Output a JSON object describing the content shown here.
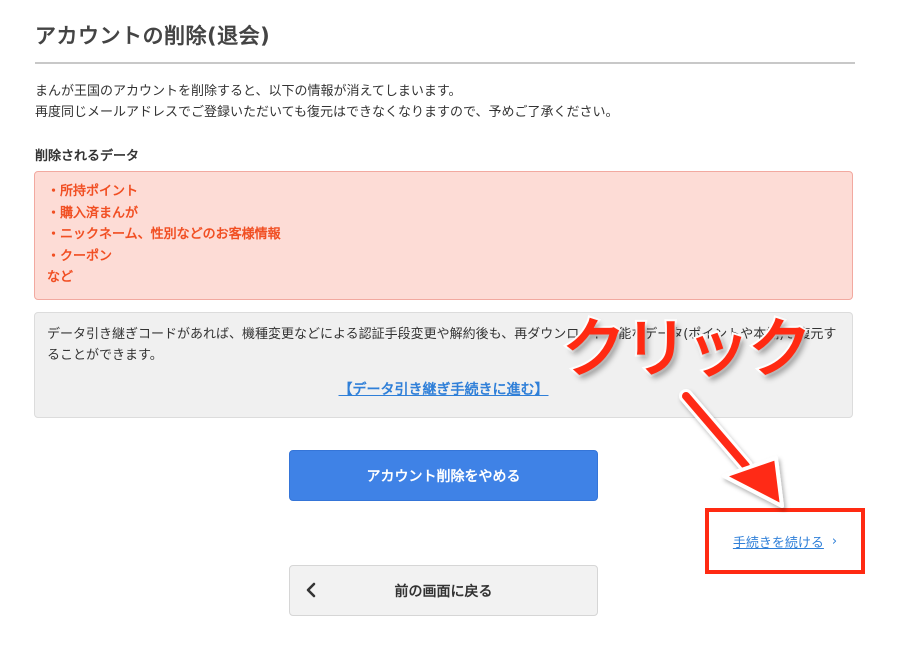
{
  "page": {
    "title": "アカウントの削除(退会)",
    "intro_lines": [
      "まんが王国のアカウントを削除すると、以下の情報が消えてしまいます。",
      "再度同じメールアドレスでご登録いただいても復元はできなくなりますので、予めご了承ください。"
    ]
  },
  "deleted_data": {
    "heading": "削除されるデータ",
    "items": [
      "・所持ポイント",
      "・購入済まんが",
      "・ニックネーム、性別などのお客様情報",
      "・クーポン",
      "など"
    ]
  },
  "transfer_info": {
    "text": "データ引き継ぎコードがあれば、機種変更などによる認証手段変更や解約後も、再ダウンロード可能なデータ(ポイントや本棚)を復元することができます。",
    "link_label": "【データ引き継ぎ手続きに進む】"
  },
  "buttons": {
    "cancel_delete_label": "アカウント削除をやめる",
    "continue_label": "手続きを続ける",
    "continue_chevron": "›",
    "back_label": "前の画面に戻る"
  },
  "annotation": {
    "text": "クリック",
    "color": "#ff2a12"
  },
  "colors": {
    "primary": "#3f82e6",
    "link": "#2f7fd8",
    "warning_text": "#f14f23",
    "warning_bg": "#fddcd6"
  },
  "icons": {
    "back": "chevron-left-icon",
    "continue": "chevron-right-icon"
  }
}
